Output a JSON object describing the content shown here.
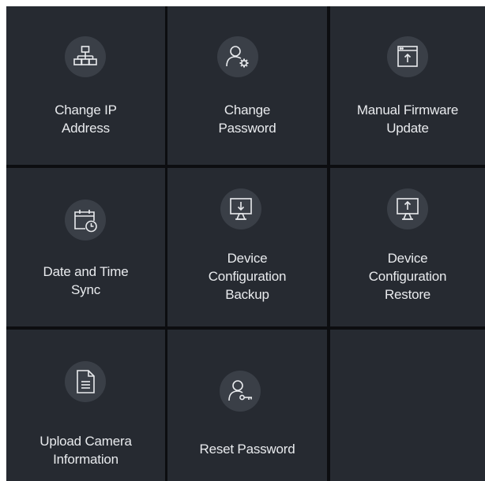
{
  "tiles": [
    {
      "icon": "network-topology-icon",
      "lines": [
        "Change IP",
        "Address"
      ]
    },
    {
      "icon": "user-settings-icon",
      "lines": [
        "Change",
        "Password"
      ]
    },
    {
      "icon": "firmware-upload-icon",
      "lines": [
        "Manual Firmware",
        "Update"
      ]
    },
    {
      "icon": "calendar-clock-icon",
      "lines": [
        "Date and Time",
        "Sync"
      ]
    },
    {
      "icon": "monitor-download-icon",
      "lines": [
        "Device",
        "Configuration",
        "Backup"
      ]
    },
    {
      "icon": "monitor-upload-icon",
      "lines": [
        "Device",
        "Configuration",
        "Restore"
      ]
    },
    {
      "icon": "document-icon",
      "lines": [
        "Upload Camera",
        "Information"
      ]
    },
    {
      "icon": "user-key-icon",
      "lines": [
        "Reset Password"
      ]
    }
  ],
  "colors": {
    "tile_bg": "#262a31",
    "grid_bg": "#0c0d10",
    "icon_circle": "#3a3f47",
    "text": "#e9ebee"
  }
}
